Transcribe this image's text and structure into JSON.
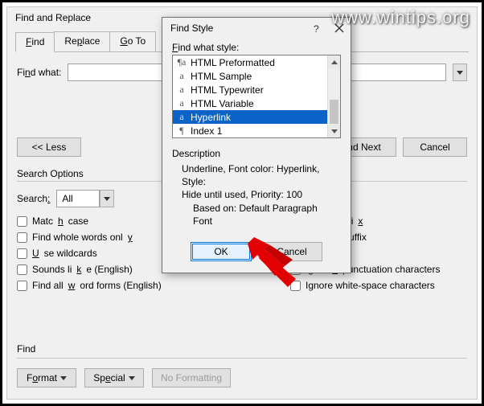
{
  "watermark": "www.wintips.org",
  "main": {
    "title": "Find and Replace",
    "tabs": {
      "find": "Find",
      "replace": "Replace",
      "goto": "Go To"
    },
    "find_what_label": "Find what:",
    "less_btn": "<< Less",
    "find_next_btn": "Find Next",
    "cancel_btn": "Cancel",
    "search_options_title": "Search Options",
    "search_label": "Search:",
    "search_value": "All",
    "checks": {
      "match_case": "Match case",
      "whole_words": "Find whole words only",
      "use_wildcards": "Use wildcards",
      "sounds_like": "Sounds like (English)",
      "all_word_forms": "Find all word forms (English)",
      "match_prefix": "Match prefix",
      "match_suffix": "Match suffix",
      "ignore_punct": "Ignore punctuation characters",
      "ignore_ws": "Ignore white-space characters"
    },
    "find_group": "Find",
    "format_btn": "Format",
    "special_btn": "Special",
    "no_formatting_btn": "No Formatting"
  },
  "modal": {
    "title": "Find Style",
    "find_what_style": "Find what style:",
    "items": {
      "preformatted": "HTML Preformatted",
      "sample": "HTML Sample",
      "typewriter": "HTML Typewriter",
      "variable": "HTML Variable",
      "hyperlink": "Hyperlink",
      "index1": "Index 1"
    },
    "description_label": "Description",
    "description_line1": "Underline, Font color: Hyperlink, Style:",
    "description_line2": "Hide until used, Priority: 100",
    "description_based": "Based on: Default Paragraph Font",
    "ok": "OK",
    "cancel": "Cancel"
  }
}
